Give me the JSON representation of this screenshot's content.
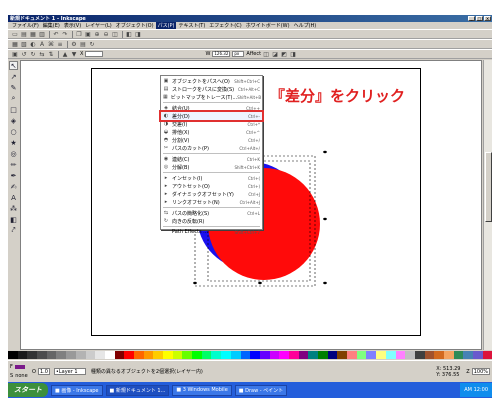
{
  "window": {
    "title": "新規ドキュメント 1 - Inkscape"
  },
  "menubar": {
    "items": [
      {
        "label": "ファイル(F)",
        "active": false
      },
      {
        "label": "編集(E)",
        "active": false
      },
      {
        "label": "表示(V)",
        "active": false
      },
      {
        "label": "レイヤー(L)",
        "active": false
      },
      {
        "label": "オブジェクト(O)",
        "active": false
      },
      {
        "label": "パス(P)",
        "active": true
      },
      {
        "label": "テキスト(T)",
        "active": false
      },
      {
        "label": "エフェクト(C)",
        "active": false
      },
      {
        "label": "ホワイトボード(W)",
        "active": false
      },
      {
        "label": "ヘルプ(H)",
        "active": false
      }
    ]
  },
  "toolbar3": {
    "x_label": "X",
    "x_value": "",
    "w_label": "W",
    "w_value": "126.32",
    "unit": "px",
    "affect_label": "Affect"
  },
  "path_menu": {
    "items": [
      {
        "icon": "object-to-path-icon",
        "glyph": "▣",
        "label": "オブジェクトをパスへ(O)",
        "shortcut": "Shift+Ctrl+C"
      },
      {
        "icon": "stroke-to-path-icon",
        "glyph": "▤",
        "label": "ストロークをパスに変換(S)",
        "shortcut": "Ctrl+Alt+C"
      },
      {
        "icon": "trace-bitmap-icon",
        "glyph": "▦",
        "label": "ビットマップをトレース(T)...",
        "shortcut": "Shift+Alt+B"
      },
      {
        "sep": true
      },
      {
        "icon": "union-icon",
        "glyph": "◈",
        "label": "結合(U)",
        "shortcut": "Ctrl++"
      },
      {
        "icon": "difference-icon",
        "glyph": "◐",
        "label": "差分(D)",
        "shortcut": "Ctrl+-",
        "hover": true
      },
      {
        "icon": "intersection-icon",
        "glyph": "◑",
        "label": "交差(I)",
        "shortcut": "Ctrl+*"
      },
      {
        "icon": "exclusion-icon",
        "glyph": "◒",
        "label": "排他(X)",
        "shortcut": "Ctrl+^"
      },
      {
        "icon": "division-icon",
        "glyph": "◓",
        "label": "分割(V)",
        "shortcut": "Ctrl+/"
      },
      {
        "icon": "cut-path-icon",
        "glyph": "✂",
        "label": "パスのカット(P)",
        "shortcut": "Ctrl+Alt+/"
      },
      {
        "sep": true
      },
      {
        "icon": "combine-icon",
        "glyph": "◉",
        "label": "連結(C)",
        "shortcut": "Ctrl+K"
      },
      {
        "icon": "break-apart-icon",
        "glyph": "◎",
        "label": "分解(B)",
        "shortcut": "Shift+Ctrl+K"
      },
      {
        "sep": true
      },
      {
        "icon": "inset-icon",
        "glyph": "▸",
        "label": "インセット(I)",
        "shortcut": "Ctrl+("
      },
      {
        "icon": "outset-icon",
        "glyph": "▸",
        "label": "アウトセット(O)",
        "shortcut": "Ctrl+)"
      },
      {
        "icon": "dynamic-offset-icon",
        "glyph": "▸",
        "label": "ダイナミックオフセット(Y)",
        "shortcut": "Ctrl+J"
      },
      {
        "icon": "linked-offset-icon",
        "glyph": "▸",
        "label": "リンクオフセット(N)",
        "shortcut": "Ctrl+Alt+J"
      },
      {
        "sep": true
      },
      {
        "icon": "reverse-icon",
        "glyph": "⇆",
        "label": "パスの簡略化(S)",
        "shortcut": "Ctrl+L"
      },
      {
        "icon": "simplify-icon",
        "glyph": "↻",
        "label": "向きの反転(R)",
        "shortcut": ""
      },
      {
        "sep": true
      },
      {
        "icon": "path-effects-icon",
        "glyph": "",
        "label": "Path Effects ...",
        "shortcut": "Shift+Ctrl+7"
      }
    ]
  },
  "annotation": {
    "text": "『差分』をクリック",
    "color": "#e02020"
  },
  "statusbar": {
    "fill_label": "F",
    "stroke_label": "S",
    "fill_color": "#7a1a8a",
    "stroke_value": "none",
    "opacity_label": "O",
    "opacity_value": "1.0",
    "layer": "•Layer 1",
    "message": "種類の異なるオブジェクトを2個選択(レイヤー内)",
    "coords_x": "X: 513.29",
    "coords_y": "Y: 376.55",
    "zoom_label": "Z",
    "zoom_value": "100%"
  },
  "taskbar": {
    "start_label": "スタート",
    "tasks": [
      {
        "label": "■ 画像 - Inkscape",
        "active": false
      },
      {
        "label": "■ 新規ドキュメント 1...",
        "active": true
      },
      {
        "label": "■ 3 Windows Mobile",
        "active": false
      },
      {
        "label": "■ Draw - ペイント",
        "active": false
      }
    ],
    "tray": "AM 12:00"
  },
  "colors": {
    "red_circle": "#ff0a0a",
    "blue_circle": "#1a10ee"
  }
}
